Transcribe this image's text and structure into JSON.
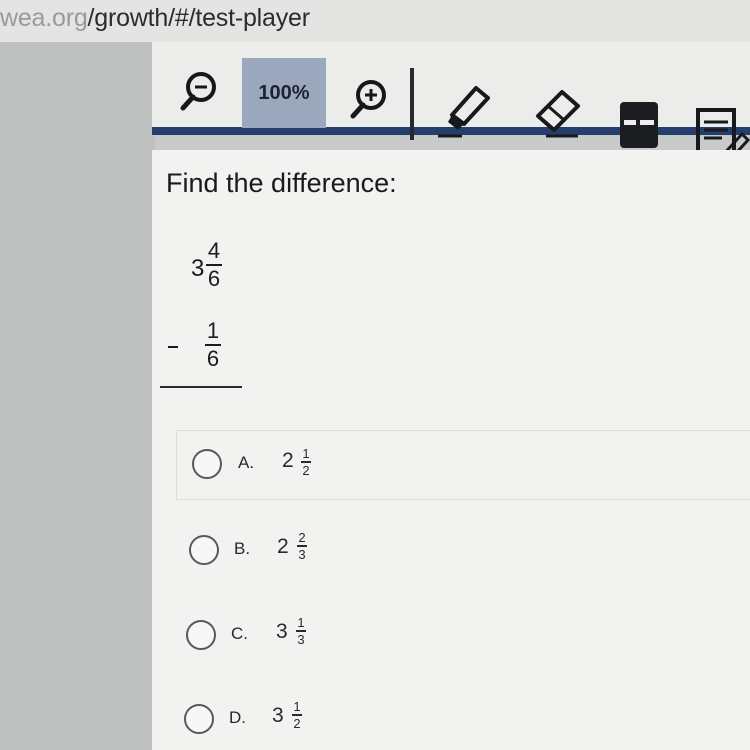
{
  "browser": {
    "url_prefix": "wea.org",
    "url_path": "/growth/#/test-player"
  },
  "toolbar": {
    "zoom_level": "100%",
    "icons": [
      "zoom-out-icon",
      "zoom-in-icon",
      "highlighter-icon",
      "eraser-icon",
      "answer-masking-icon",
      "notepad-icon"
    ]
  },
  "question": {
    "prompt": "Find the difference:",
    "minuend": {
      "whole": "3",
      "numerator": "4",
      "denominator": "6"
    },
    "operator": "-",
    "subtrahend": {
      "numerator": "1",
      "denominator": "6"
    }
  },
  "options": [
    {
      "letter": "A.",
      "whole": "2",
      "numerator": "1",
      "denominator": "2"
    },
    {
      "letter": "B.",
      "whole": "2",
      "numerator": "2",
      "denominator": "3"
    },
    {
      "letter": "C.",
      "whole": "3",
      "numerator": "1",
      "denominator": "3"
    },
    {
      "letter": "D.",
      "whole": "3",
      "numerator": "1",
      "denominator": "2"
    }
  ],
  "colors": {
    "toolbar_rule": "#243f6b",
    "zoom_box": "#9aa7bd"
  }
}
